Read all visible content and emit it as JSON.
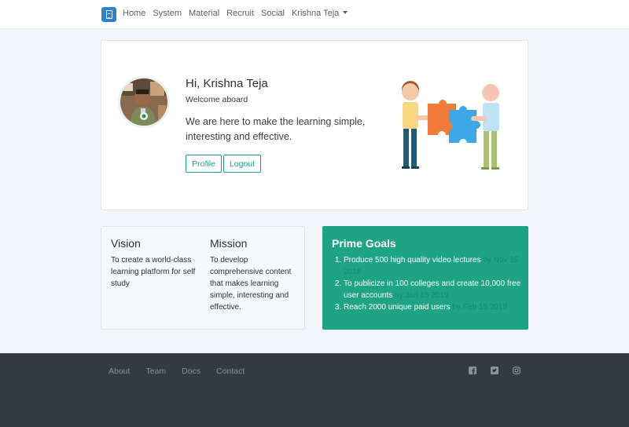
{
  "navbar": {
    "brand_icon": "book-icon",
    "links": [
      "Home",
      "System",
      "Material",
      "Recruit",
      "Social"
    ],
    "user_menu": "Krishna Teja"
  },
  "welcome": {
    "greeting": "Hi, Krishna Teja",
    "subtitle": "Welcome aboard",
    "tagline": "We are here to make the learning simple, interesting and effective.",
    "profile_label": "Profile",
    "logout_label": "Logout"
  },
  "vision": {
    "title": "Vision",
    "text": "To create a world-class learning platform for self study"
  },
  "mission": {
    "title": "Mission",
    "text": "To develop comprehensive content that makes learning simple, interesting and effective."
  },
  "goals": {
    "title": "Prime Goals",
    "items": [
      {
        "text": "Produce 500 high quality video lectures",
        "date": "by Nov 15 2018"
      },
      {
        "text": "To publicize in 100 colleges and create 10,000 free user accounts",
        "date": "by Jan 15 2019"
      },
      {
        "text": "Reach 2000 unique paid users",
        "date": "by Feb 15 2019"
      }
    ]
  },
  "footer": {
    "links": [
      "About",
      "Team",
      "Docs",
      "Contact"
    ],
    "social_icons": [
      "facebook-icon",
      "twitter-icon",
      "instagram-icon"
    ]
  },
  "colors": {
    "accent": "#1ea385",
    "brand": "#2f80d0",
    "footer_bg": "#353a42"
  }
}
